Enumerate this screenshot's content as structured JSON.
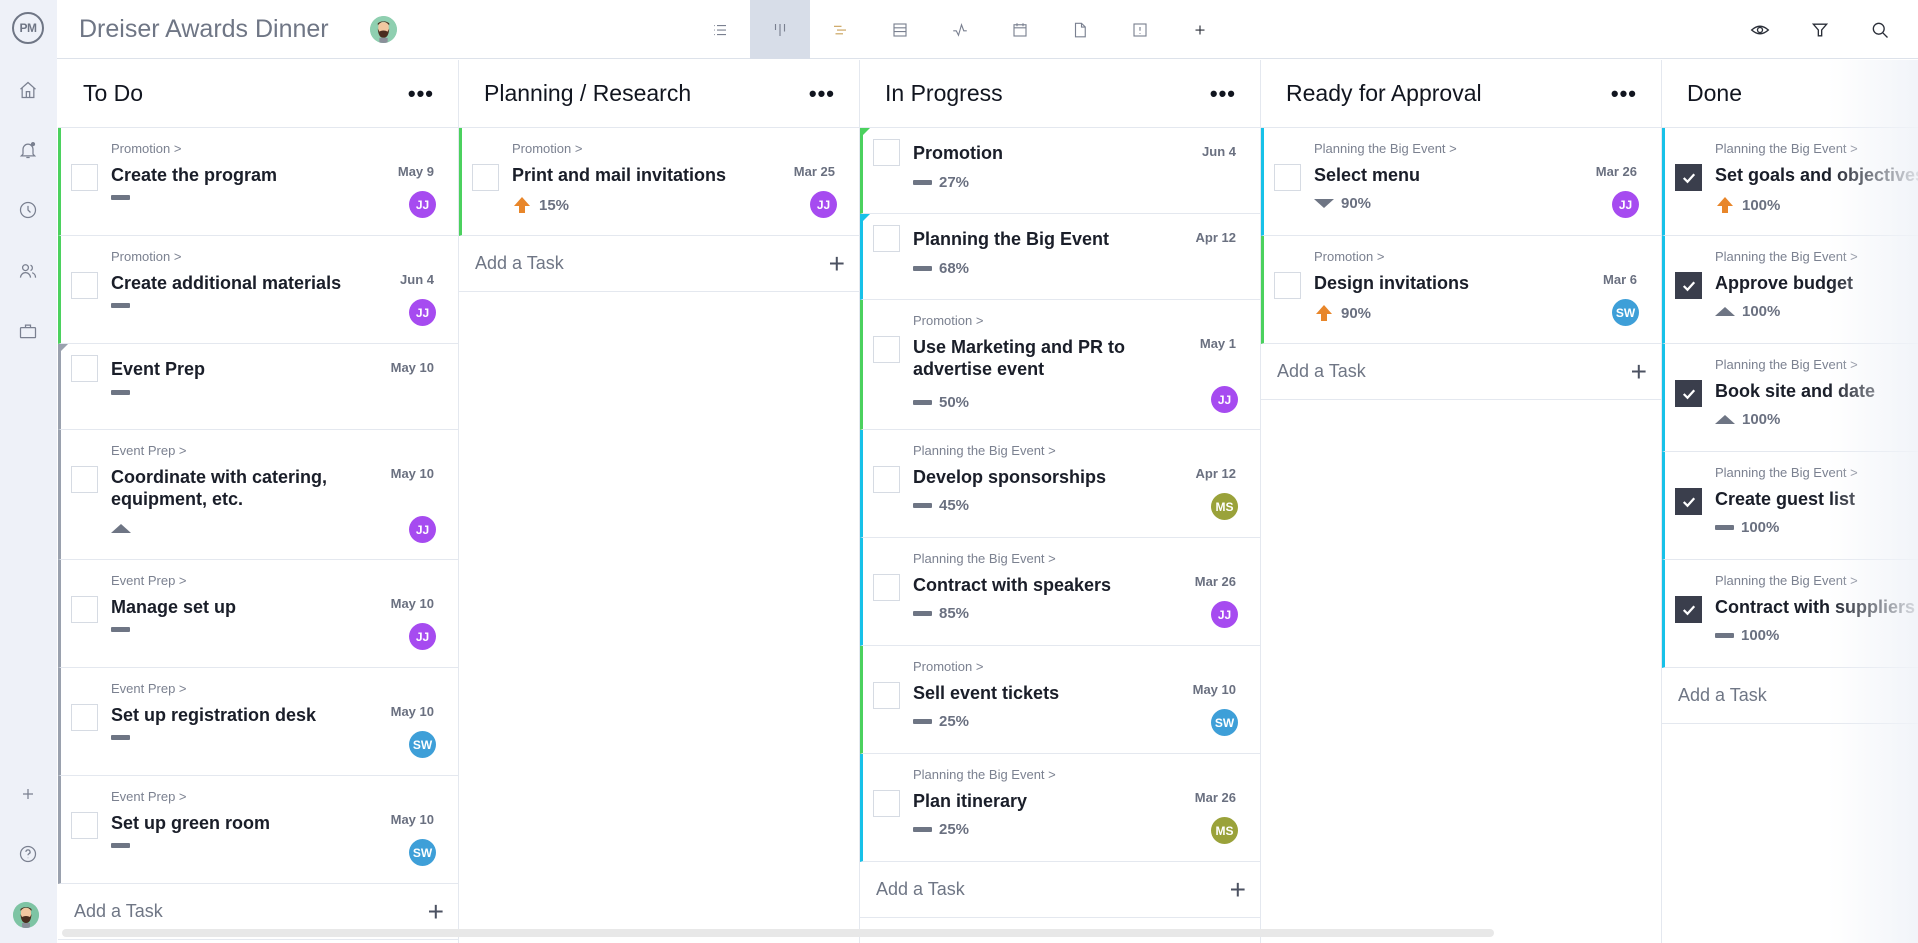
{
  "app": {
    "logo": "PM",
    "project_title": "Dreiser Awards Dinner"
  },
  "sidebar": {
    "items": [
      {
        "name": "home",
        "icon": "home-icon"
      },
      {
        "name": "notifications",
        "icon": "bell-icon"
      },
      {
        "name": "time",
        "icon": "clock-icon"
      },
      {
        "name": "team",
        "icon": "users-icon"
      },
      {
        "name": "portfolio",
        "icon": "briefcase-icon"
      }
    ],
    "bottom": [
      {
        "name": "add",
        "icon": "plus-icon"
      },
      {
        "name": "help",
        "icon": "help-icon"
      },
      {
        "name": "profile",
        "icon": "avatar"
      }
    ]
  },
  "toolbar": {
    "views": [
      {
        "name": "list",
        "icon": "list-icon",
        "active": false
      },
      {
        "name": "board",
        "icon": "board-icon",
        "active": true
      },
      {
        "name": "gantt",
        "icon": "gantt-icon",
        "active": false
      },
      {
        "name": "sheet",
        "icon": "sheet-icon",
        "active": false
      },
      {
        "name": "dashboard",
        "icon": "pulse-icon",
        "active": false
      },
      {
        "name": "calendar",
        "icon": "calendar-icon",
        "active": false
      },
      {
        "name": "files",
        "icon": "file-icon",
        "active": false
      },
      {
        "name": "risks",
        "icon": "alert-icon",
        "active": false
      },
      {
        "name": "add-view",
        "icon": "plus-icon",
        "active": false
      }
    ],
    "right": [
      {
        "name": "watch",
        "icon": "eye-icon"
      },
      {
        "name": "filter",
        "icon": "filter-icon"
      },
      {
        "name": "search",
        "icon": "search-icon"
      }
    ]
  },
  "colors": {
    "green": "#4bd15e",
    "blue": "#17c1e8",
    "gray": "#9aa1ae",
    "avatar_JJ": "#a64bf0",
    "avatar_SW": "#3e9fd8",
    "avatar_MS": "#9aa23a",
    "urgent": "#e8862a"
  },
  "board": {
    "add_task_label": "Add a Task",
    "columns": [
      {
        "title": "To Do",
        "menu": "•••",
        "cards": [
          {
            "parent": "Promotion >",
            "name": "Create the program",
            "date": "May 9",
            "assignee": "JJ",
            "priority": "medium",
            "progress": ""
          },
          {
            "parent": "Promotion >",
            "name": "Create additional materials",
            "date": "Jun 4",
            "assignee": "JJ",
            "priority": "medium",
            "progress": ""
          },
          {
            "parent": "",
            "name": "Event Prep",
            "date": "May 10",
            "assignee": "",
            "priority": "medium",
            "progress": ""
          },
          {
            "parent": "Event Prep >",
            "name": "Coordinate with catering, equipment, etc.",
            "date": "May 10",
            "assignee": "JJ",
            "priority": "high",
            "progress": ""
          },
          {
            "parent": "Event Prep >",
            "name": "Manage set up",
            "date": "May 10",
            "assignee": "JJ",
            "priority": "medium",
            "progress": ""
          },
          {
            "parent": "Event Prep >",
            "name": "Set up registration desk",
            "date": "May 10",
            "assignee": "SW",
            "priority": "medium",
            "progress": ""
          },
          {
            "parent": "Event Prep >",
            "name": "Set up green room",
            "date": "May 10",
            "assignee": "SW",
            "priority": "medium",
            "progress": ""
          }
        ]
      },
      {
        "title": "Planning / Research",
        "menu": "•••",
        "cards": [
          {
            "parent": "Promotion >",
            "name": "Print and mail invitations",
            "date": "Mar 25",
            "assignee": "JJ",
            "priority": "urgent",
            "progress": "15%"
          }
        ]
      },
      {
        "title": "In Progress",
        "menu": "•••",
        "cards": [
          {
            "parent": "",
            "name": "Promotion",
            "date": "Jun 4",
            "assignee": "",
            "priority": "medium",
            "progress": "27%"
          },
          {
            "parent": "",
            "name": "Planning the Big Event",
            "date": "Apr 12",
            "assignee": "",
            "priority": "medium",
            "progress": "68%"
          },
          {
            "parent": "Promotion >",
            "name": "Use Marketing and PR to advertise event",
            "date": "May 1",
            "assignee": "JJ",
            "priority": "medium",
            "progress": "50%"
          },
          {
            "parent": "Planning the Big Event >",
            "name": "Develop sponsorships",
            "date": "Apr 12",
            "assignee": "MS",
            "priority": "medium",
            "progress": "45%"
          },
          {
            "parent": "Planning the Big Event >",
            "name": "Contract with speakers",
            "date": "Mar 26",
            "assignee": "JJ",
            "priority": "medium",
            "progress": "85%"
          },
          {
            "parent": "Promotion >",
            "name": "Sell event tickets",
            "date": "May 10",
            "assignee": "SW",
            "priority": "medium",
            "progress": "25%"
          },
          {
            "parent": "Planning the Big Event >",
            "name": "Plan itinerary",
            "date": "Mar 26",
            "assignee": "MS",
            "priority": "medium",
            "progress": "25%"
          }
        ]
      },
      {
        "title": "Ready for Approval",
        "menu": "•••",
        "cards": [
          {
            "parent": "Planning the Big Event >",
            "name": "Select menu",
            "date": "Mar 26",
            "assignee": "JJ",
            "priority": "low",
            "progress": "90%"
          },
          {
            "parent": "Promotion >",
            "name": "Design invitations",
            "date": "Mar 6",
            "assignee": "SW",
            "priority": "urgent",
            "progress": "90%"
          }
        ]
      },
      {
        "title": "Done",
        "menu": "",
        "cards": [
          {
            "parent": "Planning the Big Event >",
            "name": "Set goals and objectives",
            "date": "",
            "assignee": "",
            "priority": "urgent",
            "progress": "100%",
            "checked": true
          },
          {
            "parent": "Planning the Big Event >",
            "name": "Approve budget",
            "date": "",
            "assignee": "",
            "priority": "high",
            "progress": "100%",
            "checked": true
          },
          {
            "parent": "Planning the Big Event >",
            "name": "Book site and date",
            "date": "",
            "assignee": "",
            "priority": "high",
            "progress": "100%",
            "checked": true
          },
          {
            "parent": "Planning the Big Event >",
            "name": "Create guest list",
            "date": "",
            "assignee": "",
            "priority": "medium",
            "progress": "100%",
            "checked": true
          },
          {
            "parent": "Planning the Big Event >",
            "name": "Contract with suppliers",
            "date": "",
            "assignee": "",
            "priority": "medium",
            "progress": "100%",
            "checked": true
          }
        ]
      }
    ]
  }
}
